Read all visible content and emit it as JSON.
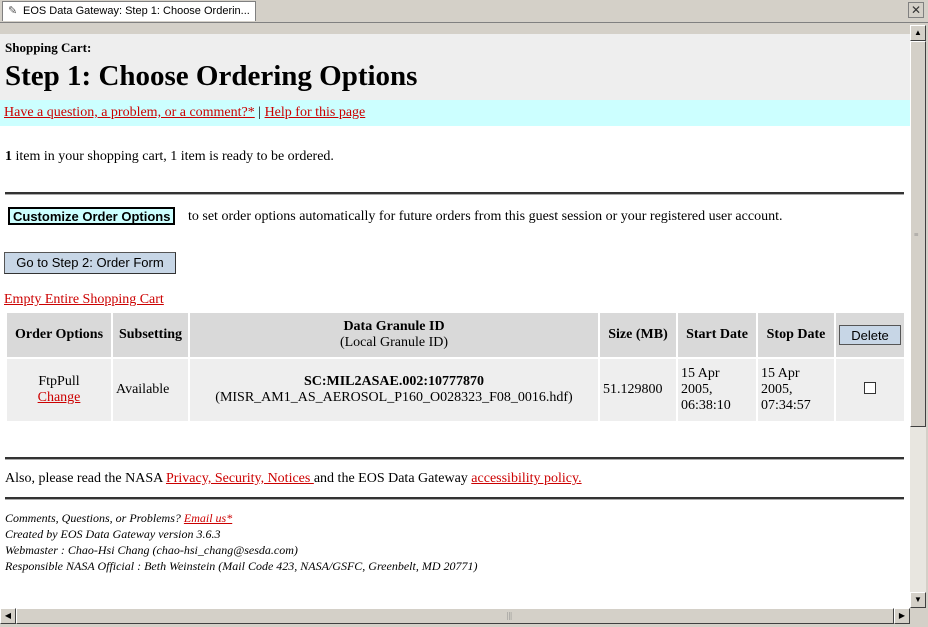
{
  "tab": {
    "title": "EOS Data Gateway: Step 1: Choose Orderin..."
  },
  "header": {
    "label": "Shopping Cart:",
    "title": "Step 1: Choose Ordering Options"
  },
  "help": {
    "question_link": "Have a question, a problem, or a comment?*",
    "separator": "|",
    "help_link": "Help for this page"
  },
  "cart_status": {
    "count": "1",
    "text": " item in your shopping cart, 1 item is ready to be ordered."
  },
  "customize": {
    "button_label": "Customize Order Options",
    "description": "to set order options automatically for future orders from this guest session or your registered user account."
  },
  "step2_button": "Go to Step 2: Order Form",
  "empty_cart_link": "Empty Entire Shopping Cart",
  "table": {
    "headers": {
      "order_options": "Order Options",
      "subsetting": "Subsetting",
      "granule_id": "Data Granule ID",
      "granule_local": "(Local Granule ID)",
      "size": "Size (MB)",
      "start_date": "Start Date",
      "stop_date": "Stop Date",
      "delete_button": "Delete"
    },
    "rows": [
      {
        "order_option": "FtpPull",
        "change_link": "Change",
        "subsetting": "Available",
        "granule_id": "SC:MIL2ASAE.002:10777870",
        "local_id": "(MISR_AM1_AS_AEROSOL_P160_O028323_F08_0016.hdf)",
        "size": "51.129800",
        "start_date_line1": "15 Apr",
        "start_date_line2": "2005,",
        "start_date_line3": "06:38:10",
        "stop_date_line1": "15 Apr",
        "stop_date_line2": "2005,",
        "stop_date_line3": "07:34:57"
      }
    ]
  },
  "also_read": {
    "prefix": "Also, please read the NASA ",
    "privacy_link": "Privacy, Security, Notices ",
    "middle": "and the EOS Data Gateway ",
    "accessibility_link": "accessibility policy."
  },
  "footer": {
    "comments_prefix": "Comments, Questions, or Problems? ",
    "email_link": "Email us*",
    "created_by": "Created by EOS Data Gateway version 3.6.3",
    "webmaster": "Webmaster : Chao-Hsi Chang (chao-hsi_chang@sesda.com)",
    "official": "Responsible NASA Official : Beth Weinstein (Mail Code 423, NASA/GSFC, Greenbelt, MD 20771)"
  },
  "colors": {
    "link": "#cc0000",
    "help_bar": "#ccffff",
    "header_bar": "#eeeeee",
    "button": "#c7d6e6"
  }
}
